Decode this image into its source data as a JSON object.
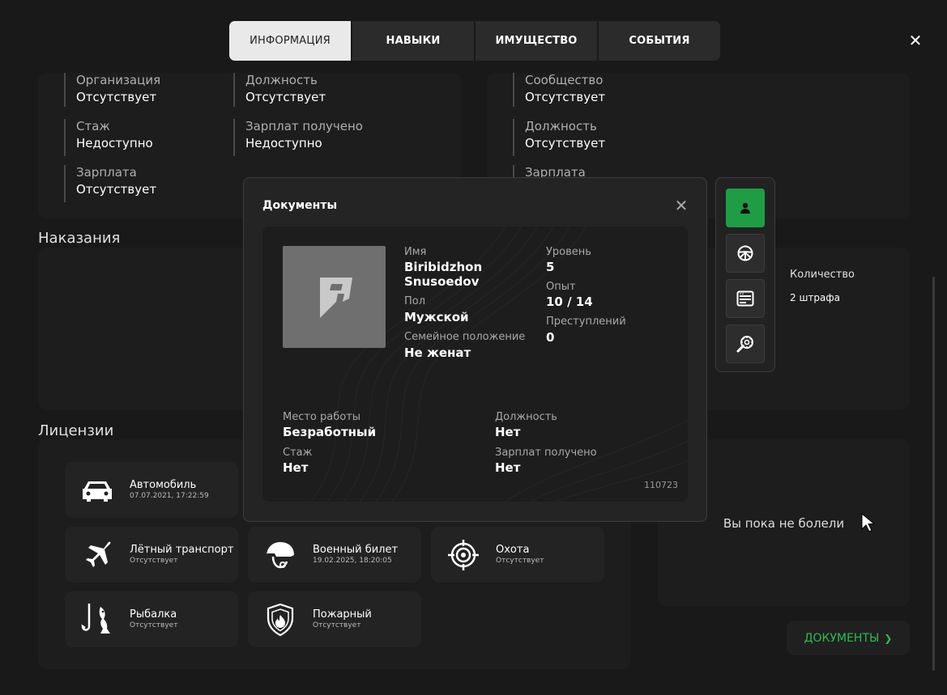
{
  "tabs": [
    {
      "label": "ИНФОРМАЦИЯ",
      "active": true
    },
    {
      "label": "НАВЫКИ",
      "active": false
    },
    {
      "label": "ИМУЩЕСТВО",
      "active": false
    },
    {
      "label": "СОБЫТИЯ",
      "active": false
    }
  ],
  "close_symbol": "✕",
  "organization": {
    "org_label": "Организация",
    "org_value": "Отсутствует",
    "pos_label": "Должность",
    "pos_value": "Отсутствует",
    "exp_label": "Стаж",
    "exp_value": "Недоступно",
    "paid_label": "Зарплат получено",
    "paid_value": "Недоступно",
    "salary_label": "Зарплата",
    "salary_value": "Отсутствует"
  },
  "community": {
    "comm_label": "Сообщество",
    "comm_value": "Отсутствует",
    "pos_label": "Должность",
    "pos_value": "Отсутствует",
    "salary_label": "Зарплата"
  },
  "punishments": {
    "title": "Наказания"
  },
  "fines": {
    "qty_label": "Количество",
    "qty_value": "2 штрафа"
  },
  "licenses": {
    "title": "Лицензии",
    "items": [
      {
        "name": "Автомобиль",
        "date": "07.07.2021, 17:22:59",
        "icon": "car-icon"
      },
      {
        "name": "Лётный транспорт",
        "date": "Отсутствует",
        "icon": "plane-icon"
      },
      {
        "name": "Военный билет",
        "date": "19.02.2025, 18:20:05",
        "icon": "helmet-icon"
      },
      {
        "name": "Охота",
        "date": "Отсутствует",
        "icon": "crosshair-icon"
      },
      {
        "name": "Рыбалка",
        "date": "Отсутствует",
        "icon": "fish-hook-icon"
      },
      {
        "name": "Пожарный",
        "date": "Отсутствует",
        "icon": "fire-shield-icon"
      }
    ]
  },
  "illness": {
    "empty_text": "Вы пока не болели"
  },
  "documents_button": {
    "label": "ДОКУМЕНТЫ",
    "arrow": "❯"
  },
  "modal": {
    "title": "Документы",
    "name_label": "Имя",
    "name_first": "Biribidzhon",
    "name_last": "Snusoedov",
    "gender_label": "Пол",
    "gender_value": "Мужской",
    "marital_label": "Семейное положение",
    "marital_value": "Не женат",
    "level_label": "Уровень",
    "level_value": "5",
    "exp_label": "Опыт",
    "exp_value": "10 / 14",
    "crimes_label": "Преступлений",
    "crimes_value": "0",
    "work_label": "Место работы",
    "work_value": "Безработный",
    "pos_label": "Должность",
    "pos_value": "Нет",
    "tenure_label": "Стаж",
    "tenure_value": "Нет",
    "paid_label": "Зарплат получено",
    "paid_value": "Нет",
    "doc_number": "110723"
  },
  "side_tools": [
    {
      "icon": "person-icon",
      "active": true
    },
    {
      "icon": "steering-wheel-icon",
      "active": false
    },
    {
      "icon": "card-icon",
      "active": false
    },
    {
      "icon": "search-gear-icon",
      "active": false
    }
  ],
  "colors": {
    "accent": "#1f9d44",
    "accent_text": "#2ebd4f",
    "bg": "#191919",
    "panel": "#1d1d1d"
  }
}
